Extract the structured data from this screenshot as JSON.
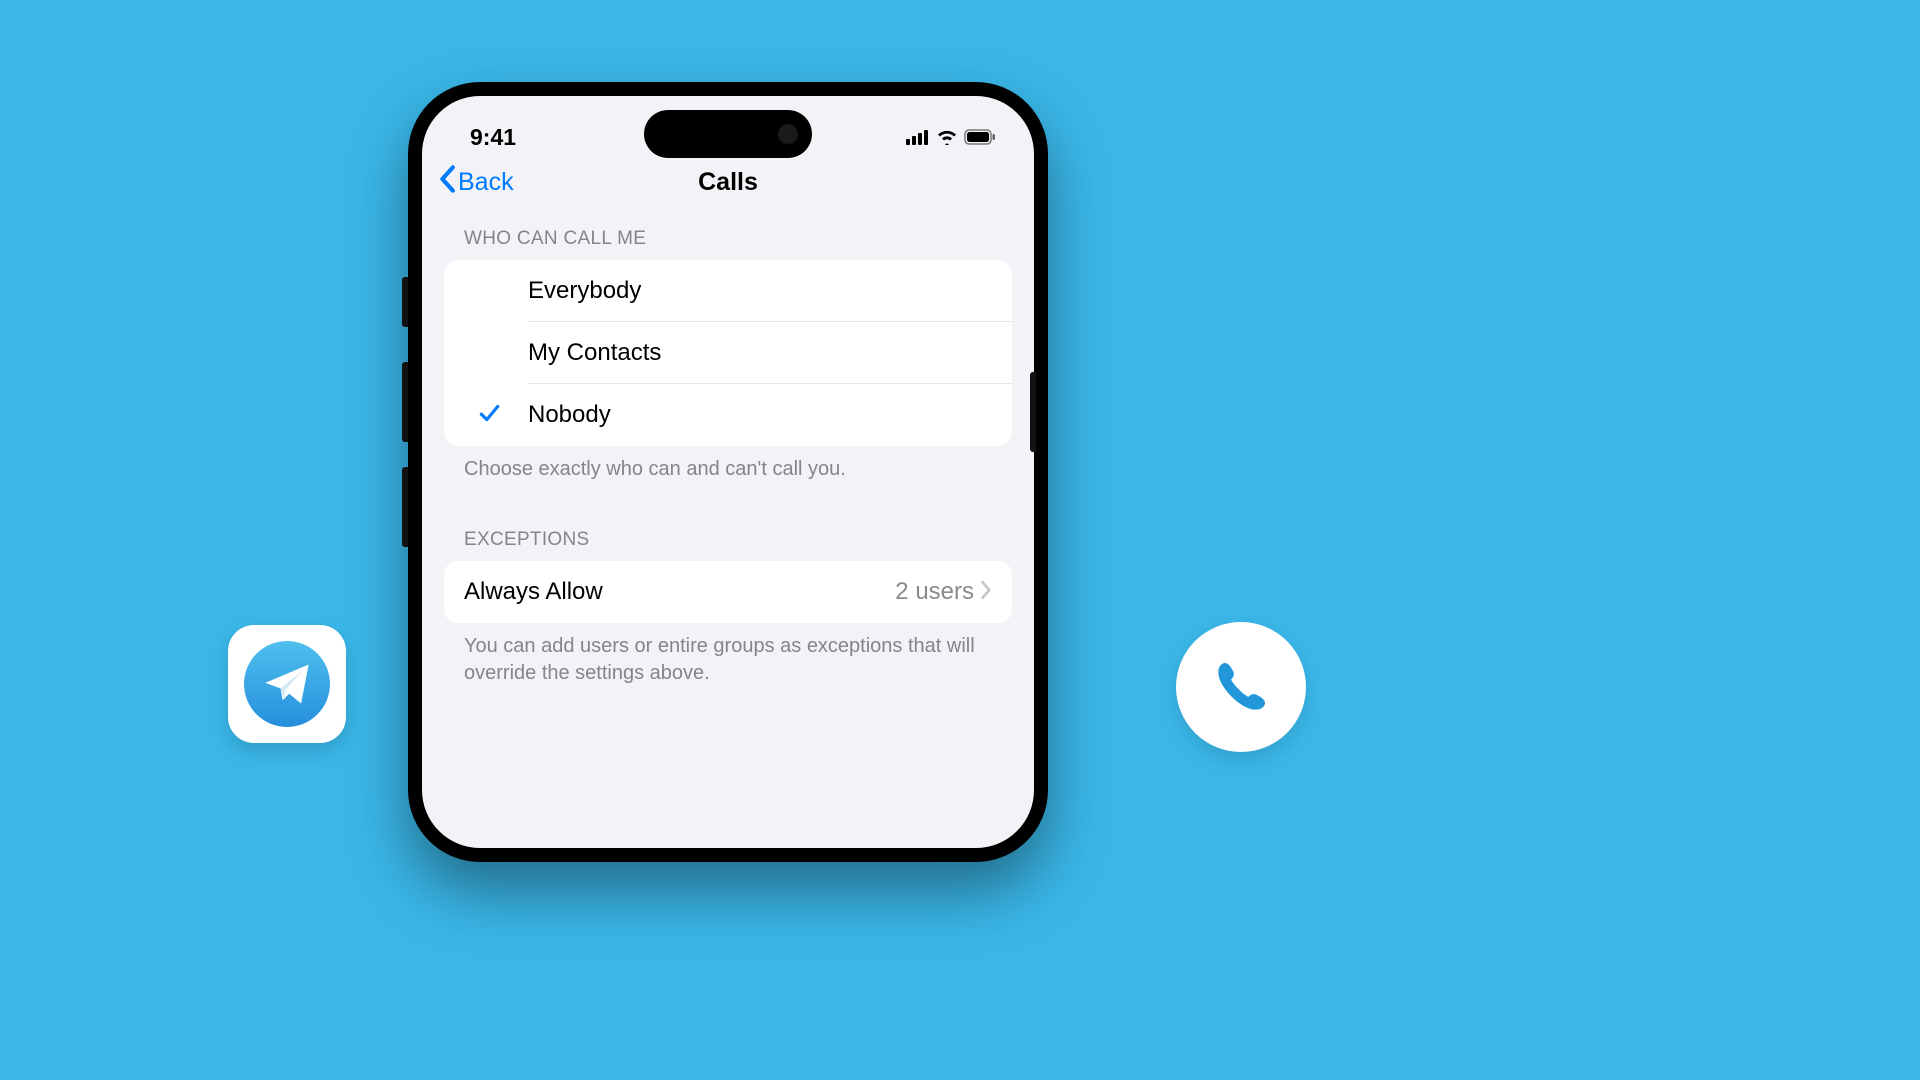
{
  "status": {
    "time": "9:41"
  },
  "nav": {
    "back": "Back",
    "title": "Calls"
  },
  "section1": {
    "header": "WHO CAN CALL ME",
    "options": [
      "Everybody",
      "My Contacts",
      "Nobody"
    ],
    "footer": "Choose exactly who can and can't call you."
  },
  "section2": {
    "header": "EXCEPTIONS",
    "row": {
      "label": "Always Allow",
      "value": "2 users"
    },
    "footer": "You can add users or entire groups as exceptions that will override the settings above."
  }
}
